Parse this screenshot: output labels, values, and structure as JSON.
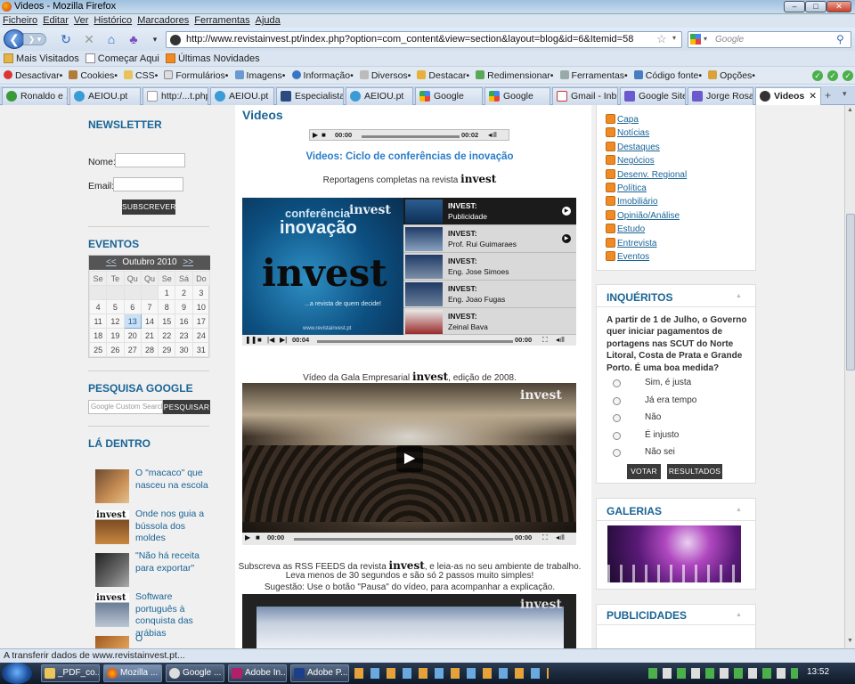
{
  "window": {
    "title": "Videos - Mozilla Firefox"
  },
  "menu": [
    "Ficheiro",
    "Editar",
    "Ver",
    "Histórico",
    "Marcadores",
    "Ferramentas",
    "Ajuda"
  ],
  "nav": {
    "url": "http://www.revistainvest.pt/index.php?option=com_content&view=section&layout=blog&id=6&Itemid=58",
    "search_placeholder": "Google"
  },
  "bookmarks": [
    "Mais Visitados",
    "Começar Aqui",
    "Últimas Novidades"
  ],
  "devtools": [
    "Desactivar•",
    "Cookies•",
    "CSS•",
    "Formulários•",
    "Imagens•",
    "Informação•",
    "Diversos•",
    "Destacar•",
    "Redimensionar•",
    "Ferramentas•",
    "Código fonte•",
    "Opções•"
  ],
  "tabs": [
    "Ronaldo e ...",
    "AEIOU.pt",
    "http:/...t.php",
    "AEIOU.pt",
    "Especialista...",
    "AEIOU.pt",
    "Google",
    "Google",
    "Gmail - Inb...",
    "Google Sites",
    "Jorge Rosa ...",
    "Videos"
  ],
  "left": {
    "newsletter": {
      "title": "NEWSLETTER",
      "name_label": "Nome:",
      "email_label": "Email:",
      "button": "SUBSCREVER"
    },
    "events": {
      "title": "EVENTOS",
      "month": "Outubro 2010",
      "prev": "<<",
      "next": ">>",
      "weekdays": [
        "Se",
        "Te",
        "Qu",
        "Qu",
        "Se",
        "Sá",
        "Do"
      ],
      "weeks": [
        [
          "",
          "",
          "",
          "",
          "1",
          "2",
          "3"
        ],
        [
          "4",
          "5",
          "6",
          "7",
          "8",
          "9",
          "10"
        ],
        [
          "11",
          "12",
          "13",
          "14",
          "15",
          "16",
          "17"
        ],
        [
          "18",
          "19",
          "20",
          "21",
          "22",
          "23",
          "24"
        ],
        [
          "25",
          "26",
          "27",
          "28",
          "29",
          "30",
          "31"
        ]
      ],
      "today": "13"
    },
    "search": {
      "title": "PESQUISA GOOGLE",
      "placeholder": "Custom Search",
      "button": "PESQUISAR",
      "google": "Google"
    },
    "inside": {
      "title": "LÁ DENTRO",
      "items": [
        {
          "text": "O \"macaco\" que nasceu na escola"
        },
        {
          "text": "Onde nos guia a bússola dos moldes",
          "tag": "invest"
        },
        {
          "text": "\"Não há receita para exportar\""
        },
        {
          "text": "Software português à conquista das arábias",
          "tag": "invest"
        },
        {
          "text": "O"
        }
      ]
    }
  },
  "center": {
    "title": "Videos",
    "player_top": {
      "t1": "00:00",
      "t2": "00:02"
    },
    "section_title": "Videos: Ciclo de conferências de inovação",
    "subtitle_pre": "Reportagens completas na revista",
    "brand": "invest",
    "video1": {
      "logo1": "conferência",
      "logo2": "inovação",
      "logo3": "invest",
      "tagline": "...a revista de quem decide!",
      "site": "www.revistainvest.pt",
      "corner": "invest",
      "playlist": [
        {
          "a": "INVEST:",
          "b": "Publicidade"
        },
        {
          "a": "INVEST:",
          "b": "Prof. Rui Guimaraes"
        },
        {
          "a": "INVEST:",
          "b": "Eng. Jose Simoes"
        },
        {
          "a": "INVEST:",
          "b": "Eng. Joao Fugas"
        },
        {
          "a": "INVEST:",
          "b": "Zeinal Bava"
        }
      ],
      "t1": "00:04",
      "t2": "00:00"
    },
    "gala_pre": "Vídeo da Gala Empresarial",
    "gala_post": ", edição de 2008.",
    "video2": {
      "corner": "invest",
      "t1": "00:00",
      "t2": "00:00"
    },
    "rss_line1_pre": "Subscreva as RSS FEEDS da revista",
    "rss_line1_post": ", e leia-as no seu ambiente de trabalho.",
    "rss_line2": "Leva menos de 30 segundos e são só 2 passos muito simples!",
    "rss_line3": "Sugestão: Use o botão \"Pausa\" do vídeo, para acompanhar a explicação.",
    "video3": {
      "corner": "invest"
    }
  },
  "right": {
    "feeds": [
      "Capa",
      "Notícias",
      "Destaques",
      "Negócios",
      "Desenv. Regional",
      "Política",
      "Imobiliário",
      "Opinião/Análise",
      "Estudo",
      "Entrevista",
      "Eventos"
    ],
    "poll": {
      "title": "INQUÉRITOS",
      "question": "A partir de 1 de Julho, o Governo quer iniciar pagamentos de portagens nas SCUT do Norte Litoral, Costa de Prata e Grande Porto. É uma boa medida?",
      "options": [
        "Sim, é justa",
        "Já era tempo",
        "Não",
        "É injusto",
        "Não sei"
      ],
      "vote": "VOTAR",
      "results": "RESULTADOS"
    },
    "gallery": {
      "title": "GALERIAS"
    },
    "ads": {
      "title": "PUBLICIDADES"
    }
  },
  "status": "A transferir dados de www.revistainvest.pt...",
  "taskbar": {
    "items": [
      "_PDF_co...",
      "Mozilla ...",
      "Google ...",
      "Adobe In...",
      "Adobe P..."
    ],
    "clock": "13:52"
  }
}
